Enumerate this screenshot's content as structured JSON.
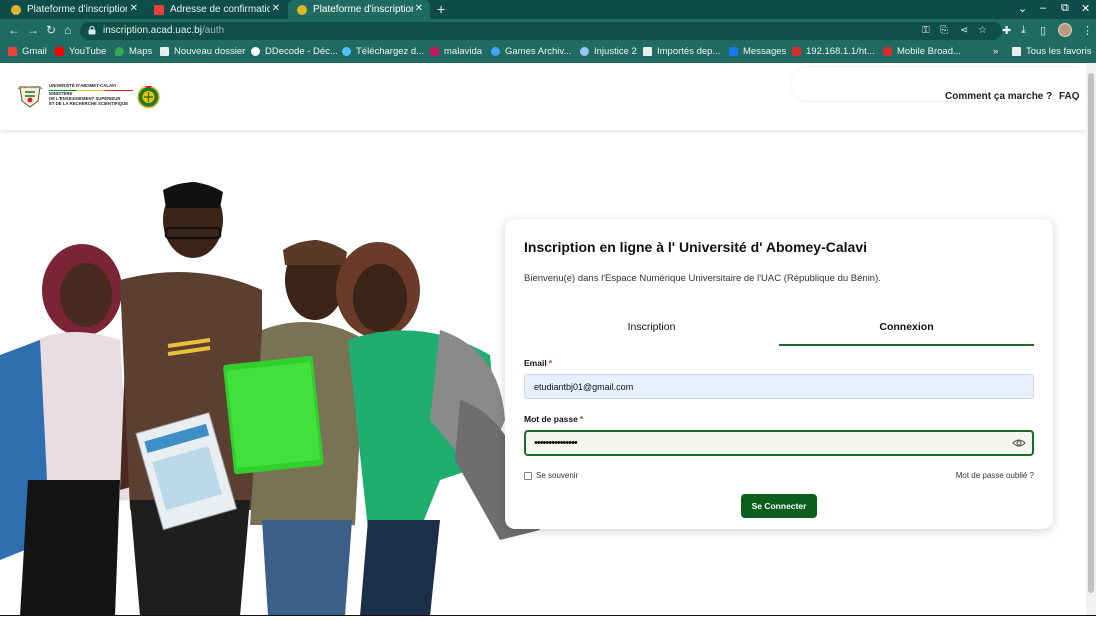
{
  "browser": {
    "tabs": [
      {
        "title": "Plateforme d'inscription",
        "favicon_color": "#e0b52a",
        "active": false
      },
      {
        "title": "Adresse de confirmation",
        "favicon_color": "#ea4335",
        "active": false
      },
      {
        "title": "Plateforme d'inscription",
        "favicon_color": "#e0b52a",
        "active": true
      }
    ],
    "new_tab": "+",
    "url_host": "inscription.acad.uac.bj",
    "url_path": "/auth",
    "bookmarks": [
      {
        "label": "Gmail",
        "color": "#ea4335"
      },
      {
        "label": "YouTube",
        "color": "#ff0000"
      },
      {
        "label": "Maps",
        "color": "#34a853"
      },
      {
        "label": "Nouveau dossier",
        "color": "#e8eaed"
      },
      {
        "label": "DDecode - Déc...",
        "color": "#ffffff"
      },
      {
        "label": "Téléchargez d...",
        "color": "#4fc3f7"
      },
      {
        "label": "malavida",
        "color": "#c2185b"
      },
      {
        "label": "Games Archiv...",
        "color": "#42a5f5"
      },
      {
        "label": "Injustice 2",
        "color": "#90caf9"
      },
      {
        "label": "Importés dep...",
        "color": "#e8eaed"
      },
      {
        "label": "Messages",
        "color": "#1877f2"
      },
      {
        "label": "192.168.1.1/ht...",
        "color": "#d32f2f"
      },
      {
        "label": "Mobile Broad...",
        "color": "#d32f2f"
      }
    ],
    "bookmarks_overflow": "»",
    "all_bookmarks": "Tous les favoris"
  },
  "header": {
    "logo_lines": [
      "UNIVERSITÉ D'ABOMEY-CALAVI",
      "MINISTÈRE",
      "DE L'ENSEIGNEMENT SUPÉRIEUR",
      "ET DE LA RECHERCHE SCIENTIFIQUE"
    ],
    "nav": [
      "Comment ça marche ?",
      "FAQ"
    ]
  },
  "card": {
    "title": "Inscription en ligne à l' Université d' Abomey-Calavi",
    "subtitle": "Bienvenu(e) dans l'Espace Numérique Universitaire de l'UAC (République du Bénin).",
    "tabs": {
      "inscription": "Inscription",
      "connexion": "Connexion",
      "active": "Connexion"
    },
    "email_label": "Email",
    "email_value": "etudiantbj01@gmail.com",
    "password_label": "Mot de passe",
    "password_value": "•••••••••••••••",
    "required_mark": "*",
    "remember_label": "Se souvenir",
    "forgot_label": "Mot de passe oublié ?",
    "submit_label": "Se Connecter",
    "accent_color": "#1d6b2b"
  }
}
